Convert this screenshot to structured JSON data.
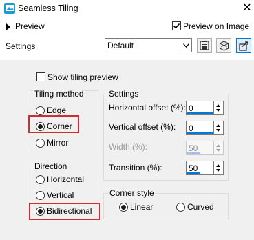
{
  "window": {
    "title": "Seamless Tiling",
    "close_glyph": "✕"
  },
  "preview": {
    "label": "Preview",
    "preview_on_image_label": "Preview on Image",
    "preview_on_image_checked": true
  },
  "settings_row": {
    "label": "Settings",
    "preset": "Default"
  },
  "show_tiling_preview": {
    "label": "Show tiling preview",
    "checked": false
  },
  "tiling_method": {
    "title": "Tiling method",
    "options": [
      {
        "label": "Edge",
        "selected": false
      },
      {
        "label": "Corner",
        "selected": true
      },
      {
        "label": "Mirror",
        "selected": false
      }
    ]
  },
  "settings_group": {
    "title": "Settings",
    "fields": [
      {
        "label": "Horizontal offset (%):",
        "value": "0",
        "enabled": true
      },
      {
        "label": "Vertical offset (%):",
        "value": "0",
        "enabled": true
      },
      {
        "label": "Width (%):",
        "value": "50",
        "enabled": false
      },
      {
        "label": "Transition (%):",
        "value": "50",
        "enabled": true
      }
    ]
  },
  "direction": {
    "title": "Direction",
    "options": [
      {
        "label": "Horizontal",
        "selected": false
      },
      {
        "label": "Vertical",
        "selected": false
      },
      {
        "label": "Bidirectional",
        "selected": true
      }
    ]
  },
  "corner_style": {
    "title": "Corner style",
    "options": [
      {
        "label": "Linear",
        "selected": true
      },
      {
        "label": "Curved",
        "selected": false
      }
    ]
  },
  "colors": {
    "accent": "#0078d7",
    "highlight": "#d32a3a",
    "panel_bg": "#f0f0f0"
  },
  "icons": [
    "app-icon",
    "save-icon",
    "cube-icon",
    "load-preset-icon",
    "chevron-down-icon",
    "caret-right-icon",
    "checkmark-icon"
  ]
}
